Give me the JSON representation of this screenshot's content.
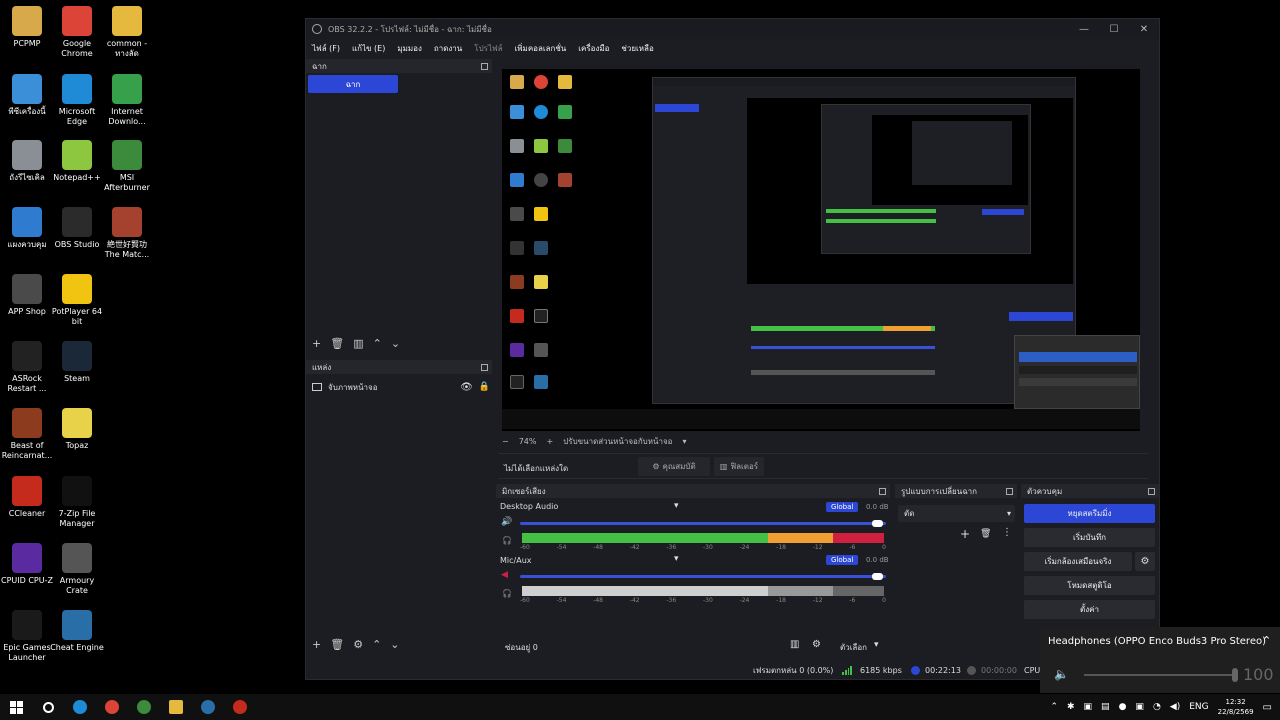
{
  "desktop": {
    "icons": [
      {
        "label": "PCPMP",
        "color": "#d7a94a"
      },
      {
        "label": "Google Chrome",
        "color": "#db4437"
      },
      {
        "label": "common - ทางลัด",
        "color": "#e5b93e"
      },
      {
        "label": "พีซีเครื่องนี้",
        "color": "#3b8fd9"
      },
      {
        "label": "Microsoft Edge",
        "color": "#1f8ad6"
      },
      {
        "label": "Internet Downlo...",
        "color": "#37a04a"
      },
      {
        "label": "ถังรีไซเคิล",
        "color": "#8a8f96"
      },
      {
        "label": "Notepad++",
        "color": "#8dc63f"
      },
      {
        "label": "MSI Afterburner",
        "color": "#3c8a3c"
      },
      {
        "label": "แผงควบคุม",
        "color": "#2f7bd0"
      },
      {
        "label": "OBS Studio",
        "color": "#2b2b2b"
      },
      {
        "label": "絶世好賢功 The Matc...",
        "color": "#a5422f"
      },
      {
        "label": "APP Shop",
        "color": "#4a4a4a"
      },
      {
        "label": "PotPlayer 64 bit",
        "color": "#f2c412"
      },
      {
        "label": "ASRock Restart ...",
        "color": "#222"
      },
      {
        "label": "Steam",
        "color": "#1b2838"
      },
      {
        "label": "Beast of Reincarnat...",
        "color": "#8c3b1e"
      },
      {
        "label": "Topaz",
        "color": "#e7d24a"
      },
      {
        "label": "CCleaner",
        "color": "#c42b1c"
      },
      {
        "label": "7-Zip File Manager",
        "color": "#111"
      },
      {
        "label": "CPUID CPU-Z",
        "color": "#5a2aa0"
      },
      {
        "label": "Armoury Crate",
        "color": "#555"
      },
      {
        "label": "Epic Games Launcher",
        "color": "#1a1a1a"
      },
      {
        "label": "Cheat Engine",
        "color": "#2a6ea8"
      }
    ]
  },
  "obs": {
    "title": "OBS 32.2.2 - โปรไฟล์: ไม่มีชื่อ - ฉาก: ไม่มีชื่อ",
    "menu": [
      "ไฟล์ (F)",
      "แก้ไข (E)",
      "มุมมอง",
      "ถาดงาน",
      "โปรไฟล์",
      "เพิ่มคอลเลกชั่น",
      "เครื่องมือ",
      "ช่วยเหลือ"
    ],
    "scenes": {
      "header": "ฉาก",
      "items": [
        "ฉาก"
      ]
    },
    "sources": {
      "header": "แหล่ง",
      "items": [
        "จับภาพหน้าจอ"
      ]
    },
    "preview_bar": {
      "zoom": "74%",
      "label": "ปรับขนาดส่วนหน้าจอกับหน้าจอ"
    },
    "source_toolbar": {
      "no_source": "ไม่ได้เลือกแหล่งใด",
      "properties": "คุณสมบัติ",
      "filters": "ฟิลเตอร์"
    },
    "mixer": {
      "header": "มิกเซอร์เสียง",
      "tracks": [
        {
          "name": "Desktop Audio",
          "global": "Global",
          "db": "0.0 dB"
        },
        {
          "name": "Mic/Aux",
          "global": "Global",
          "db": "0.0 dB"
        }
      ],
      "ticks": [
        "-60",
        "-54",
        "-48",
        "-42",
        "-36",
        "-30",
        "-24",
        "-18",
        "-12",
        "-6",
        "0"
      ],
      "hidden_label": "ซ่อนอยู่ 0",
      "options_label": "ตัวเลือก"
    },
    "transitions": {
      "header": "รูปแบบการเปลี่ยนฉาก",
      "selected": "ตัด"
    },
    "controls": {
      "header": "ตัวควบคุม",
      "buttons": [
        "หยุดสตรีมมิ่ง",
        "เริ่มบันทึก",
        "เริ่มกล้องเสมือนจริง",
        "โหมดสตูดิโอ",
        "ตั้งค่า"
      ]
    },
    "status": {
      "dropped": "เฟรมตกหล่น 0 (0.0%)",
      "bitrate": "6185 kbps",
      "stream_time": "00:22:13",
      "rec_time": "00:00:00",
      "cpu": "CPU"
    }
  },
  "popup": {
    "device": "Headphones (OPPO Enco Buds3 Pro Stereo)",
    "volume": "100"
  },
  "taskbar": {
    "lang": "ENG",
    "time": "12:32",
    "date": "22/8/2569"
  }
}
